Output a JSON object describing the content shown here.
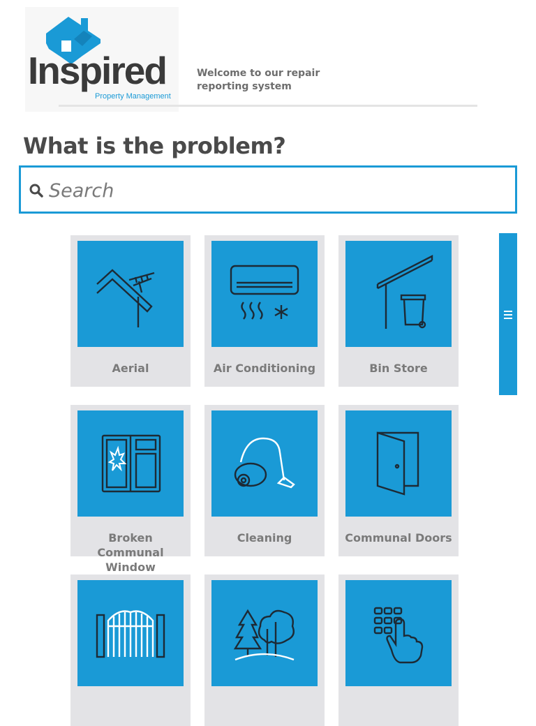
{
  "brand": {
    "name": "Inspired",
    "subtitle": "Property Management",
    "welcome": "Welcome to our repair reporting system",
    "accent_color": "#1a9ad6"
  },
  "main": {
    "question": "What is the problem?",
    "search": {
      "placeholder": "Search",
      "value": ""
    }
  },
  "categories": [
    {
      "label": "Aerial",
      "icon": "aerial-icon"
    },
    {
      "label": "Air Conditioning",
      "icon": "air-conditioning-icon"
    },
    {
      "label": "Bin Store",
      "icon": "bin-store-icon"
    },
    {
      "label": "Broken Communal Window",
      "icon": "broken-window-icon"
    },
    {
      "label": "Cleaning",
      "icon": "vacuum-cleaner-icon"
    },
    {
      "label": "Communal Doors",
      "icon": "door-icon"
    },
    {
      "label": "",
      "icon": "gate-icon"
    },
    {
      "label": "",
      "icon": "trees-icon"
    },
    {
      "label": "",
      "icon": "keypad-icon"
    }
  ],
  "side_tab": {
    "icon": "menu-icon"
  }
}
